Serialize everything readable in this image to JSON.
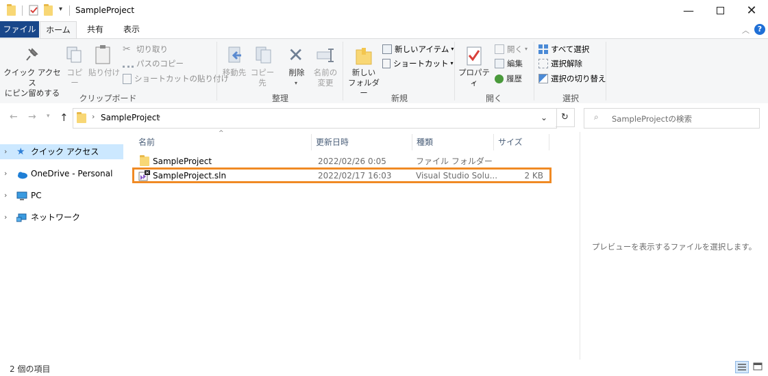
{
  "window": {
    "title": "SampleProject",
    "minimize_icon": "minimize-icon",
    "maximize_icon": "maximize-icon",
    "close_icon": "close-icon"
  },
  "tabs": [
    "ファイル",
    "ホーム",
    "共有",
    "表示"
  ],
  "ribbon": {
    "clipboard": {
      "pin_label_1": "クイック アクセス",
      "pin_label_2": "にピン留めする",
      "copy": "コピー",
      "paste": "貼り付け",
      "cut": "切り取り",
      "copy_path": "パスのコピー",
      "paste_shortcut": "ショートカットの貼り付け",
      "group": "クリップボード"
    },
    "organize": {
      "move_to": "移動先",
      "copy_to": "コピー先",
      "delete": "削除",
      "rename_1": "名前の",
      "rename_2": "変更",
      "group": "整理"
    },
    "new": {
      "new_folder_1": "新しい",
      "new_folder_2": "フォルダー",
      "new_item": "新しいアイテム",
      "easy_access": "ショートカット",
      "group": "新規"
    },
    "open": {
      "properties": "プロパティ",
      "open": "開く",
      "edit": "編集",
      "history": "履歴",
      "group": "開く"
    },
    "select": {
      "select_all": "すべて選択",
      "select_none": "選択解除",
      "invert": "選択の切り替え",
      "group": "選択"
    }
  },
  "address": {
    "path": "SampleProject",
    "search_placeholder": "SampleProjectの検索"
  },
  "nav": [
    {
      "label": "クイック アクセス",
      "icon": "star-icon",
      "selected": true
    },
    {
      "label": "OneDrive - Personal",
      "icon": "cloud-icon",
      "selected": false
    },
    {
      "label": "PC",
      "icon": "computer-icon",
      "selected": false
    },
    {
      "label": "ネットワーク",
      "icon": "network-icon",
      "selected": false
    }
  ],
  "columns": {
    "name": "名前",
    "date": "更新日時",
    "type": "種類",
    "size": "サイズ"
  },
  "files": [
    {
      "name": "SampleProject",
      "date": "2022/02/26 0:05",
      "type": "ファイル フォルダー",
      "size": "",
      "icon": "folder-icon"
    },
    {
      "name": "SampleProject.sln",
      "date": "2022/02/17 16:03",
      "type": "Visual Studio Solu...",
      "size": "2 KB",
      "icon": "vs-solution-icon"
    }
  ],
  "preview": {
    "message": "プレビューを表示するファイルを選択します。"
  },
  "status": {
    "item_count": "2 個の項目"
  },
  "colors": {
    "file_tab": "#19478a",
    "selected_nav": "#cce8ff",
    "highlight": "#f08a24"
  }
}
